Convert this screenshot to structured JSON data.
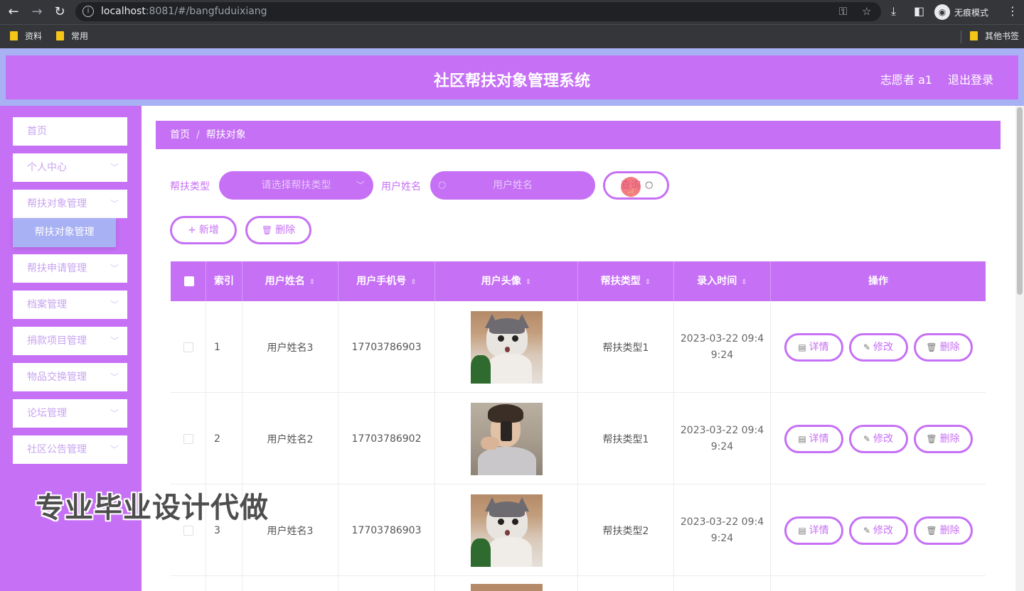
{
  "browser": {
    "url_host": "localhost",
    "url_rest": ":8081/#/bangfuduixiang",
    "incognito_label": "无痕模式",
    "bookmarks": [
      "资料",
      "常用"
    ],
    "other_bookmarks": "其他书签"
  },
  "header": {
    "title": "社区帮扶对象管理系统",
    "user": "志愿者 a1",
    "logout": "退出登录"
  },
  "sidebar": {
    "items": [
      {
        "label": "首页",
        "has_chevron": false
      },
      {
        "label": "个人中心",
        "has_chevron": true
      },
      {
        "label": "帮扶对象管理",
        "has_chevron": true
      },
      {
        "label": "帮扶申请管理",
        "has_chevron": true
      },
      {
        "label": "档案管理",
        "has_chevron": true
      },
      {
        "label": "捐款项目管理",
        "has_chevron": true
      },
      {
        "label": "物品交换管理",
        "has_chevron": true
      },
      {
        "label": "论坛管理",
        "has_chevron": true
      },
      {
        "label": "社区公告管理",
        "has_chevron": true
      }
    ],
    "active_sub": "帮扶对象管理"
  },
  "watermark": "专业毕业设计代做",
  "breadcrumb": {
    "home": "首页",
    "current": "帮扶对象"
  },
  "filters": {
    "type_label": "帮扶类型",
    "type_placeholder": "请选择帮扶类型",
    "name_label": "用户姓名",
    "name_placeholder": "用户姓名",
    "query_button": "查询"
  },
  "actions": {
    "add": "新增",
    "delete": "删除"
  },
  "table": {
    "headers": [
      "索引",
      "用户姓名",
      "用户手机号",
      "用户头像",
      "帮扶类型",
      "录入时间",
      "操作"
    ],
    "rows": [
      {
        "index": "1",
        "name": "用户姓名3",
        "phone": "17703786903",
        "avatar": "cat-photo",
        "type": "帮扶类型1",
        "time": "2023-03-22 09:4\n9:24"
      },
      {
        "index": "2",
        "name": "用户姓名2",
        "phone": "17703786902",
        "avatar": "person-photo",
        "type": "帮扶类型1",
        "time": "2023-03-22 09:4\n9:24"
      },
      {
        "index": "3",
        "name": "用户姓名3",
        "phone": "17703786903",
        "avatar": "cat-photo",
        "type": "帮扶类型2",
        "time": "2023-03-22 09:4\n9:24"
      }
    ],
    "op_labels": {
      "detail": "详情",
      "edit": "修改",
      "delete": "删除"
    }
  },
  "colors": {
    "accent": "#c670f5",
    "frame": "#a8b1f3"
  }
}
